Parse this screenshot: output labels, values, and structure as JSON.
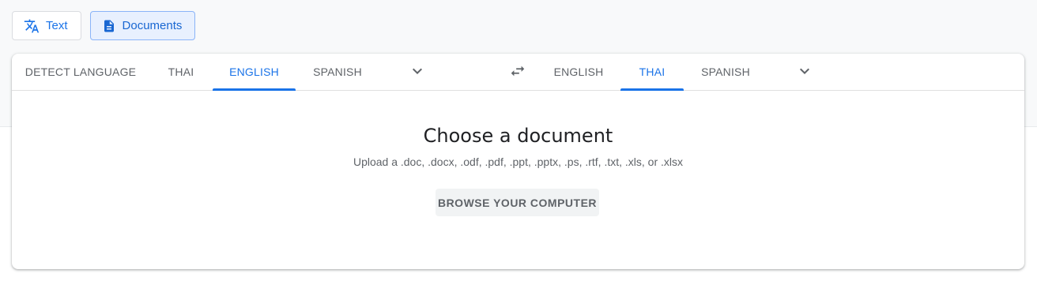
{
  "mode_switch": {
    "text_label": "Text",
    "documents_label": "Documents",
    "active": "Documents"
  },
  "source_langs": {
    "tabs": [
      "DETECT LANGUAGE",
      "THAI",
      "ENGLISH",
      "SPANISH"
    ],
    "active": "ENGLISH"
  },
  "target_langs": {
    "tabs": [
      "ENGLISH",
      "THAI",
      "SPANISH"
    ],
    "active": "THAI"
  },
  "icons": {
    "text_mode": "translate-icon",
    "documents_mode": "document-icon",
    "source_more": "chevron-down-icon",
    "swap": "swap-languages-icon",
    "target_more": "chevron-down-icon"
  },
  "document": {
    "title": "Choose a document",
    "subtitle": "Upload a .doc, .docx, .odf, .pdf, .ppt, .pptx, .ps, .rtf, .txt, .xls, or .xlsx",
    "browse_label": "BROWSE YOUR COMPUTER"
  },
  "colors": {
    "accent": "#1a73e8",
    "text_secondary": "#5f6368",
    "active_mode_bg": "#e8f0fe"
  }
}
